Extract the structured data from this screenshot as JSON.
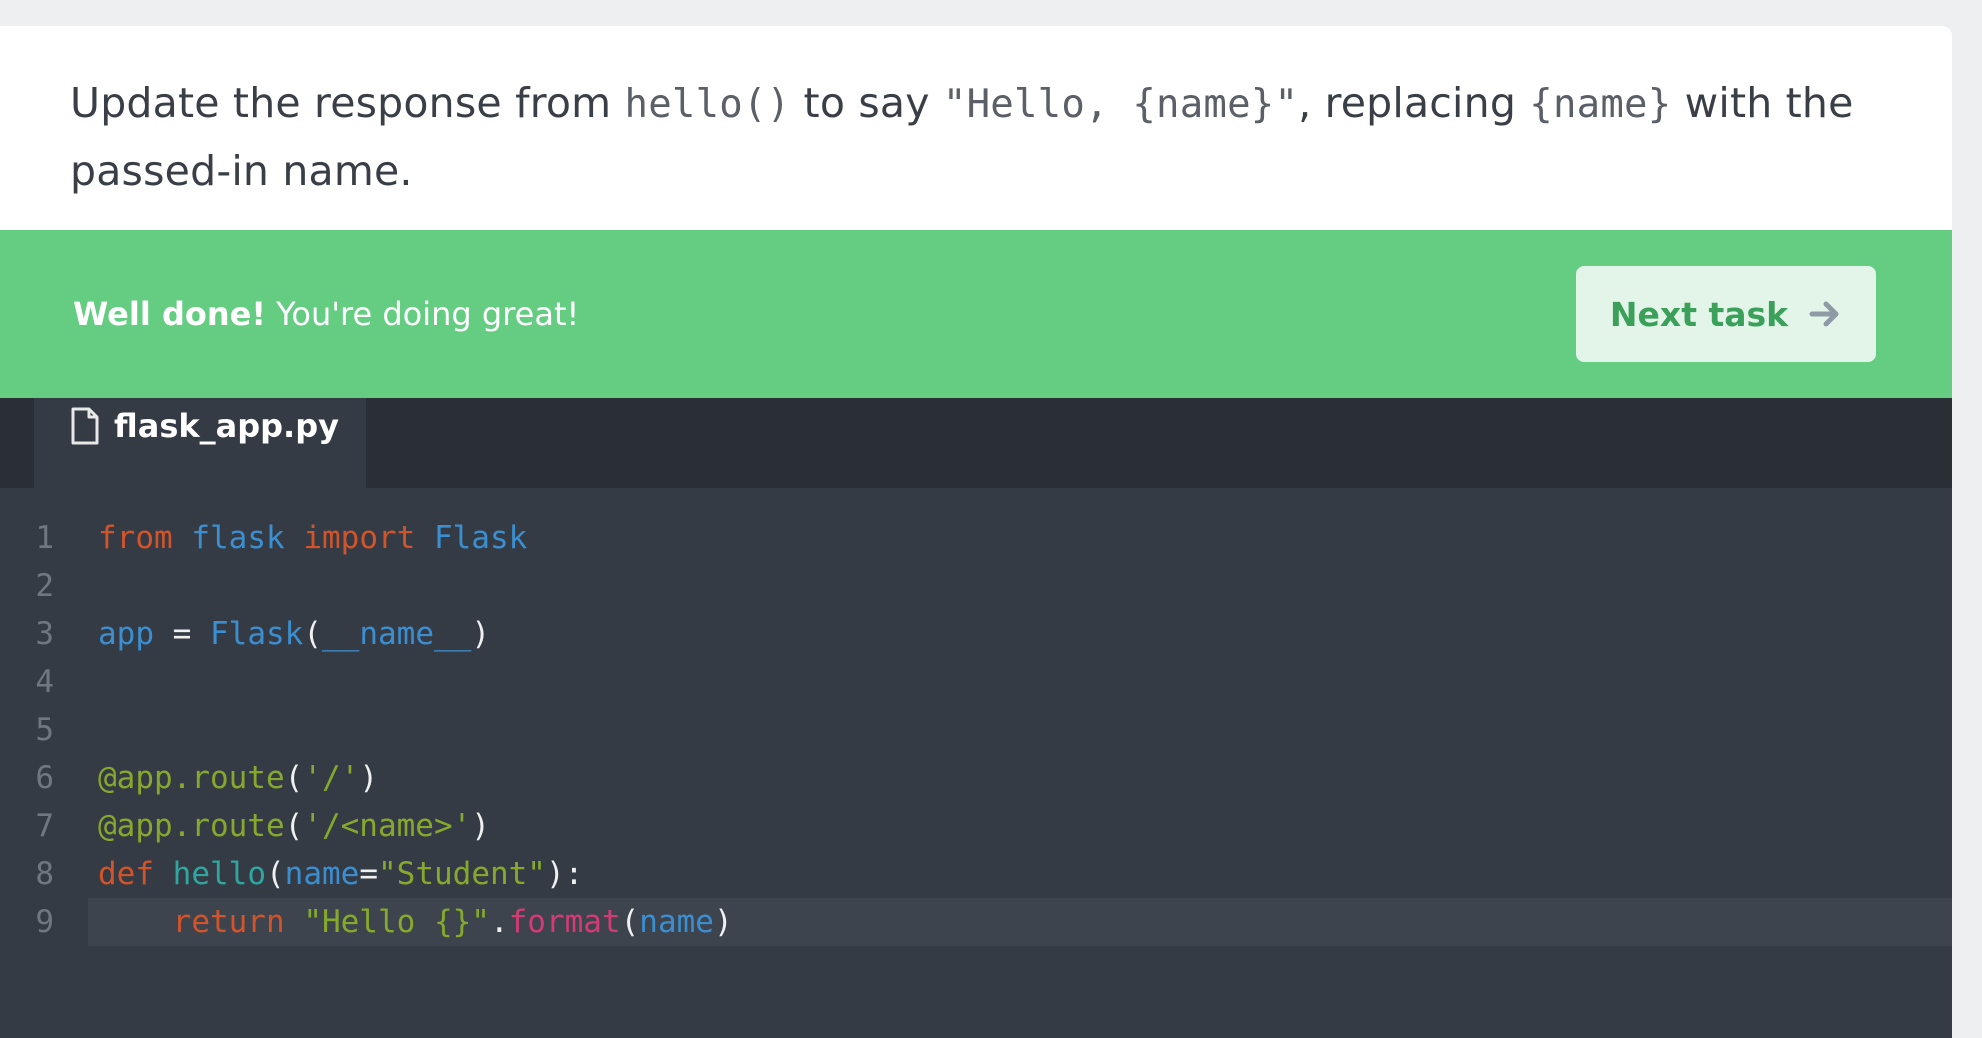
{
  "task": {
    "t1": "Update the response from ",
    "c1": "hello()",
    "t2": " to say ",
    "c2": "\"Hello, {name}\"",
    "t3": ", replacing ",
    "c3": "{name}",
    "t4": " with the passed-in name."
  },
  "banner": {
    "strong": "Well done!",
    "light": " You're doing great!",
    "next_label": "Next task",
    "color": "#64cd82"
  },
  "editor": {
    "tab_label": "flask_app.py",
    "icons": {
      "file": "file-icon",
      "arrow": "arrow-right-icon"
    },
    "lines": [
      {
        "n": "1",
        "tokens": [
          {
            "t": "from",
            "c": "kw"
          },
          {
            "t": " ",
            "c": "wh"
          },
          {
            "t": "flask",
            "c": "bl"
          },
          {
            "t": " ",
            "c": "wh"
          },
          {
            "t": "import",
            "c": "kw"
          },
          {
            "t": " ",
            "c": "wh"
          },
          {
            "t": "Flask",
            "c": "bl"
          }
        ]
      },
      {
        "n": "2",
        "tokens": []
      },
      {
        "n": "3",
        "tokens": [
          {
            "t": "app",
            "c": "bl"
          },
          {
            "t": " = ",
            "c": "wh"
          },
          {
            "t": "Flask",
            "c": "bl"
          },
          {
            "t": "(",
            "c": "wh"
          },
          {
            "t": "__name__",
            "c": "bl"
          },
          {
            "t": ")",
            "c": "wh"
          }
        ]
      },
      {
        "n": "4",
        "tokens": []
      },
      {
        "n": "5",
        "tokens": []
      },
      {
        "n": "6",
        "tokens": [
          {
            "t": "@app.route",
            "c": "gr"
          },
          {
            "t": "(",
            "c": "wh"
          },
          {
            "t": "'/'",
            "c": "gr"
          },
          {
            "t": ")",
            "c": "wh"
          }
        ]
      },
      {
        "n": "7",
        "tokens": [
          {
            "t": "@app.route",
            "c": "gr"
          },
          {
            "t": "(",
            "c": "wh"
          },
          {
            "t": "'/<name>'",
            "c": "gr"
          },
          {
            "t": ")",
            "c": "wh"
          }
        ]
      },
      {
        "n": "8",
        "tokens": [
          {
            "t": "def",
            "c": "kw"
          },
          {
            "t": " ",
            "c": "wh"
          },
          {
            "t": "hello",
            "c": "tl"
          },
          {
            "t": "(",
            "c": "wh"
          },
          {
            "t": "name",
            "c": "bl"
          },
          {
            "t": "=",
            "c": "wh"
          },
          {
            "t": "\"Student\"",
            "c": "gr"
          },
          {
            "t": "):",
            "c": "wh"
          }
        ]
      },
      {
        "n": "9",
        "active": true,
        "tokens": [
          {
            "t": "    ",
            "c": "wh"
          },
          {
            "t": "return",
            "c": "kw"
          },
          {
            "t": " ",
            "c": "wh"
          },
          {
            "t": "\"Hello {}\"",
            "c": "gr"
          },
          {
            "t": ".",
            "c": "wh"
          },
          {
            "t": "format",
            "c": "mg"
          },
          {
            "t": "(",
            "c": "wh"
          },
          {
            "t": "name",
            "c": "bl"
          },
          {
            "t": ")",
            "c": "wh"
          }
        ]
      }
    ]
  }
}
